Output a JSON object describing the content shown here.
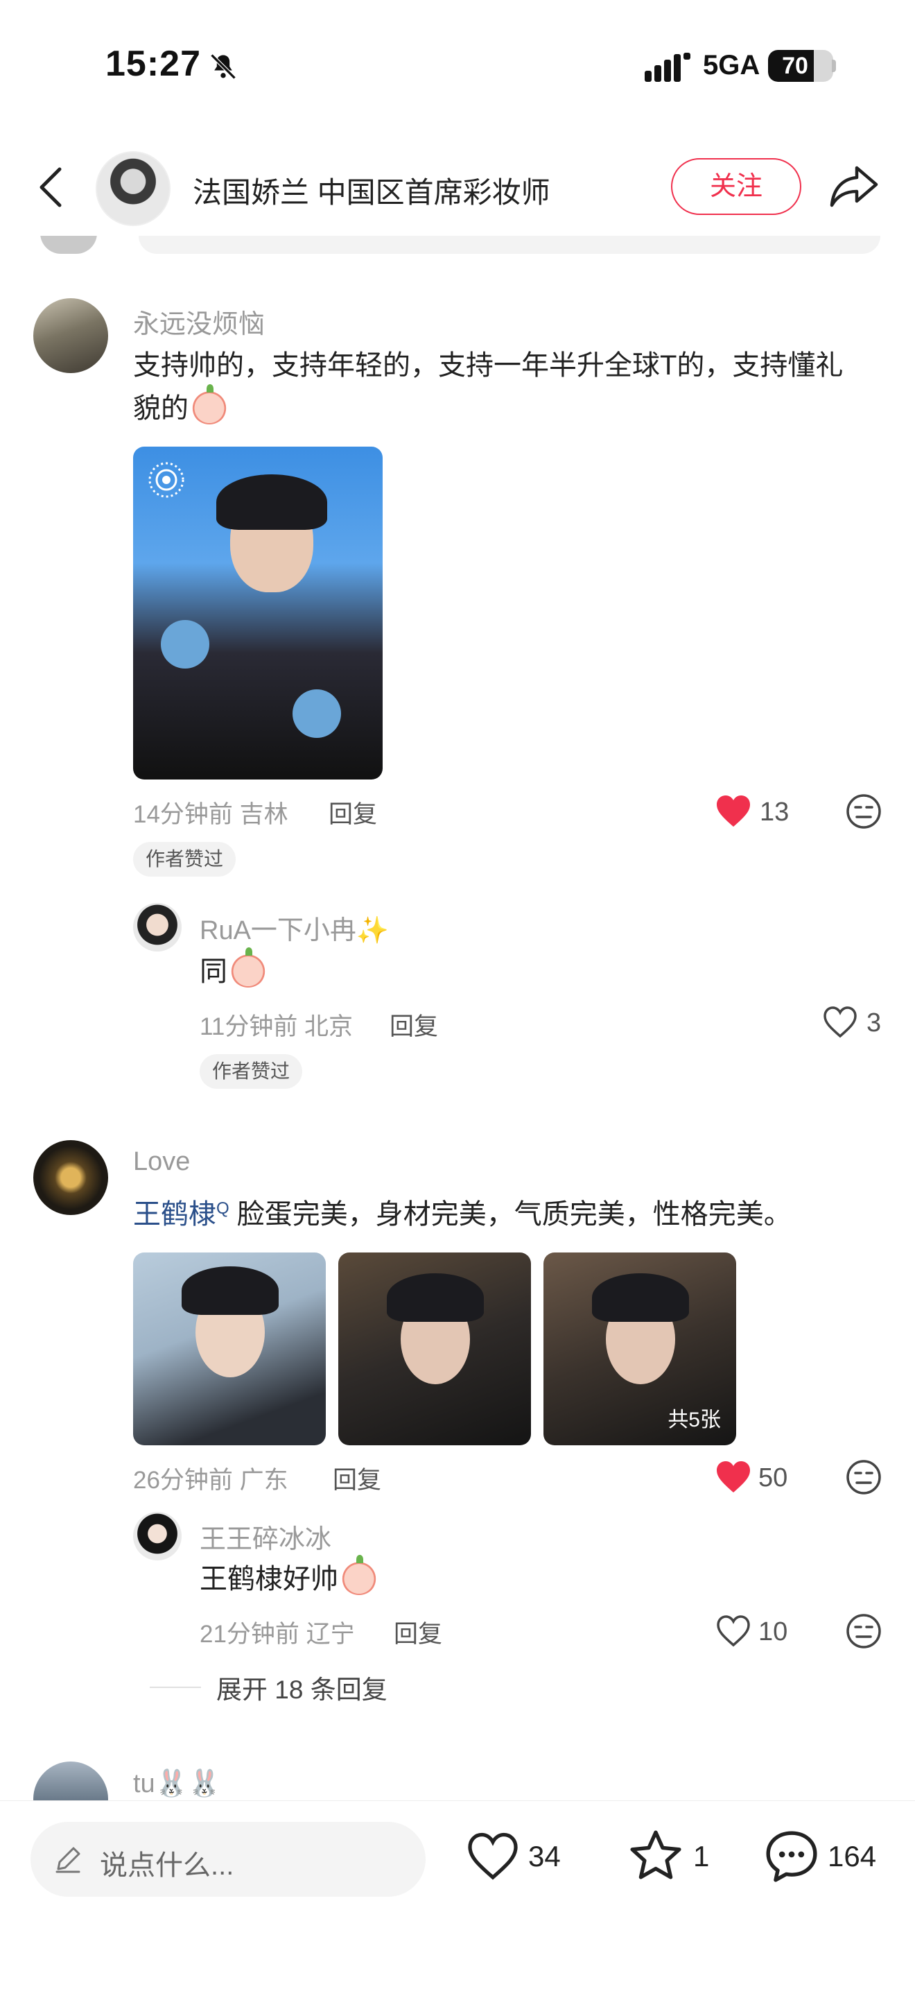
{
  "status_bar": {
    "time": "15:27",
    "network": "5GA",
    "battery": "70",
    "battery_level": 0.7
  },
  "header": {
    "title": "法国娇兰 中国区首席彩妆师",
    "follow_label": "关注"
  },
  "comments": [
    {
      "user": "永远没烦恼",
      "text": "支持帅的，支持年轻的，支持一年半升全球T的，支持懂礼",
      "text_line2": "貌的",
      "time_location": "14分钟前 吉林",
      "reply_label": "回复",
      "likes": "13",
      "badge": "作者赞过"
    },
    {
      "user": "RuA一下小冉✨",
      "text": "同",
      "time_location": "11分钟前 北京",
      "reply_label": "回复",
      "likes": "3",
      "badge": "作者赞过"
    },
    {
      "user": "Love",
      "link_text": "王鹤棣",
      "text": "脸蛋完美，身材完美，气质完美，性格完美。",
      "time_location": "26分钟前 广东",
      "reply_label": "回复",
      "likes": "50",
      "images_count_label": "共5张"
    },
    {
      "user": "王王碎冰冰",
      "text": "王鹤棣好帅",
      "time_location": "21分钟前 辽宁",
      "reply_label": "回复",
      "likes": "10"
    },
    {
      "user": "tu🐰🐰"
    }
  ],
  "expand_replies": "展开 18 条回复",
  "bottom_bar": {
    "input_placeholder": "说点什么...",
    "likes": "34",
    "favorites": "1",
    "comments": "164"
  },
  "colors": {
    "accent": "#f0304d",
    "link": "#2a4f8a"
  }
}
